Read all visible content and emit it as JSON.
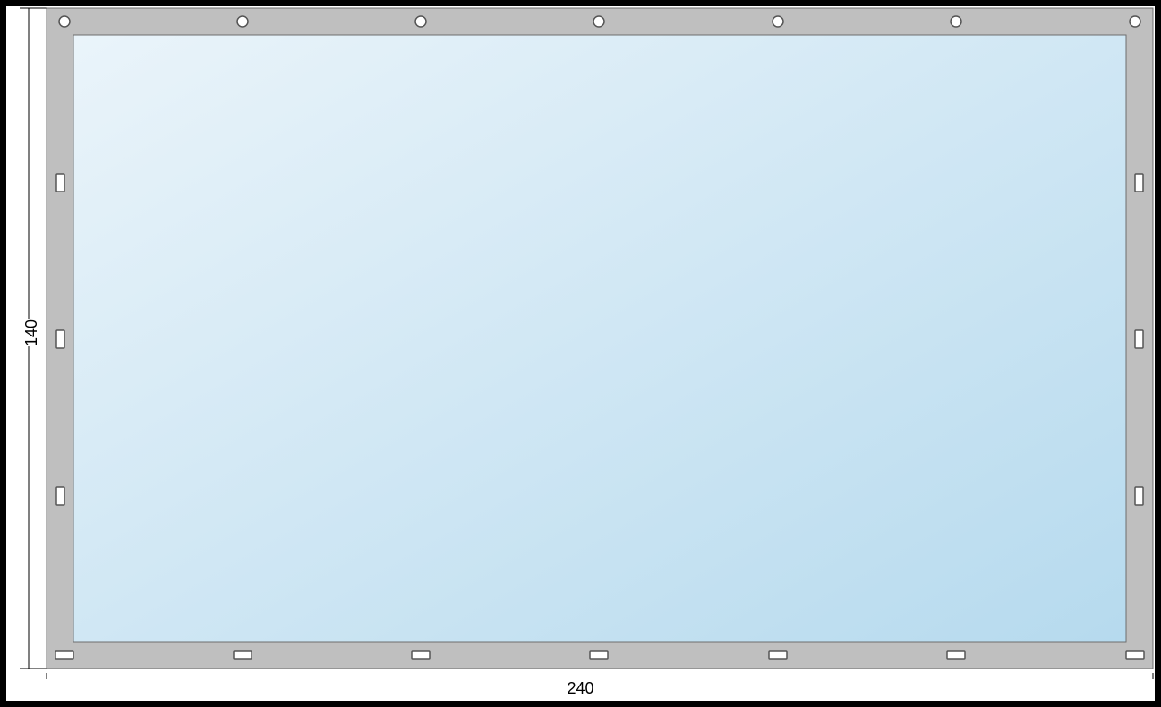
{
  "dimensions": {
    "width_label": "240",
    "height_label": "140"
  },
  "frame": {
    "border_width_px": 30,
    "border_color": "#bfbfbf",
    "inner_fill_start": "#e6f1f7",
    "inner_fill_end": "#bcdff0"
  },
  "fasteners": {
    "top": {
      "type": "circle",
      "count": 7
    },
    "bottom": {
      "type": "h-slot",
      "count": 7
    },
    "left": {
      "type": "v-slot",
      "count": 3
    },
    "right": {
      "type": "v-slot",
      "count": 3
    }
  }
}
